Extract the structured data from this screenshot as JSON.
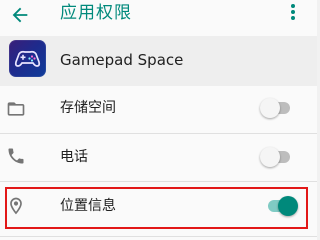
{
  "topbar": {
    "title": "应用权限",
    "back_icon": "arrow-left-icon",
    "more_icon": "more-vert-icon",
    "accent": "#00897b"
  },
  "app": {
    "name": "Gamepad Space",
    "icon": "gamepad-icon"
  },
  "permissions": [
    {
      "label": "存储空间",
      "icon": "folder-icon",
      "enabled": false
    },
    {
      "label": "电话",
      "icon": "phone-icon",
      "enabled": false
    },
    {
      "label": "位置信息",
      "icon": "location-icon",
      "enabled": true
    }
  ],
  "highlight_color": "#e21818"
}
